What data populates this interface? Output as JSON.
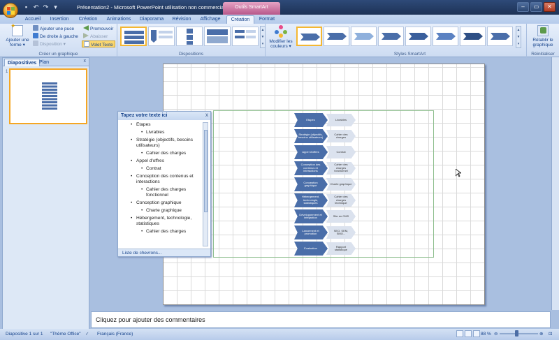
{
  "window": {
    "title": "Présentation2 - Microsoft PowerPoint utilisation non commerciale",
    "contextual_tab_header": "Outils SmartArt",
    "min": "–",
    "max": "▭",
    "close": "✕"
  },
  "qat": [
    "save-icon",
    "undo-icon",
    "redo-icon",
    "customize-icon"
  ],
  "tabs": [
    {
      "label": "Accueil"
    },
    {
      "label": "Insertion"
    },
    {
      "label": "Création"
    },
    {
      "label": "Animations"
    },
    {
      "label": "Diaporama"
    },
    {
      "label": "Révision"
    },
    {
      "label": "Affichage"
    },
    {
      "label": "Création"
    },
    {
      "label": "Format"
    }
  ],
  "ribbon": {
    "create_graphic": {
      "label": "Créer un graphique",
      "add_shape": "Ajouter une forme ▾",
      "add_bullet": "Ajouter une puce",
      "right_to_left": "De droite à gauche",
      "layout": "Disposition ▾",
      "promote": "Promouvoir",
      "demote": "Abaisser",
      "text_pane": "Volet Texte"
    },
    "layouts": {
      "label": "Dispositions"
    },
    "styles": {
      "label": "Styles SmartArt",
      "change_colors": "Modifier les couleurs ▾"
    },
    "reset": {
      "label": "Réinitialiser",
      "reset_graphic": "Rétablir le graphique"
    }
  },
  "left_pane": {
    "tab_slides": "Diapositives",
    "tab_outline": "Plan",
    "close": "x",
    "slide_number": "1"
  },
  "text_pane": {
    "title": "Tapez votre texte ici",
    "close": "x",
    "footer": "Liste de chevrons...",
    "items": [
      {
        "level": 1,
        "text": "Etapes"
      },
      {
        "level": 2,
        "text": "Livrables"
      },
      {
        "level": 1,
        "text": "Stratégie (objectifs, besoins utilisateurs)"
      },
      {
        "level": 2,
        "text": "Cahier des charges"
      },
      {
        "level": 1,
        "text": "Appel d'offres"
      },
      {
        "level": 2,
        "text": "Contrat"
      },
      {
        "level": 1,
        "text": "Conception des contenus et interactions"
      },
      {
        "level": 2,
        "text": "Cahier des charges fonctionnel"
      },
      {
        "level": 1,
        "text": "Conception graphique"
      },
      {
        "level": 2,
        "text": "Charte graphique"
      },
      {
        "level": 1,
        "text": "Hébergement, technologie, statistiques"
      },
      {
        "level": 2,
        "text": "Cahier des charges"
      }
    ]
  },
  "smartart": {
    "rows": [
      {
        "a": "Etapes",
        "b": "Livrables"
      },
      {
        "a": "Stratégie (objectifs, besoins utilisateurs)",
        "b": "Cahier des charges"
      },
      {
        "a": "Appel d'offres",
        "b": "Contrat"
      },
      {
        "a": "Conception des contenus et interactions",
        "b": "Cahier des charges fonctionnel"
      },
      {
        "a": "Conception graphique",
        "b": "Charte graphique"
      },
      {
        "a": "Hébergement, technologie, statistiques",
        "b": "Cahier des charges technique"
      },
      {
        "a": "Développement et intégration",
        "b": "Site en CMS"
      },
      {
        "a": "Lancement et promotion",
        "b": "SEO, SEM, SMO..."
      },
      {
        "a": "Evaluation",
        "b": "Rapport statistique"
      }
    ]
  },
  "notes": {
    "placeholder": "Cliquez pour ajouter des commentaires"
  },
  "status": {
    "slide": "Diapositive 1 sur 1",
    "theme": "\"Thème Office\"",
    "language": "Français (France)",
    "zoom": "88 %"
  },
  "colors": {
    "chevron_dark": "#4a6ea9",
    "chevron_light": "#dbe2ee",
    "selected_border": "#f4b732"
  }
}
